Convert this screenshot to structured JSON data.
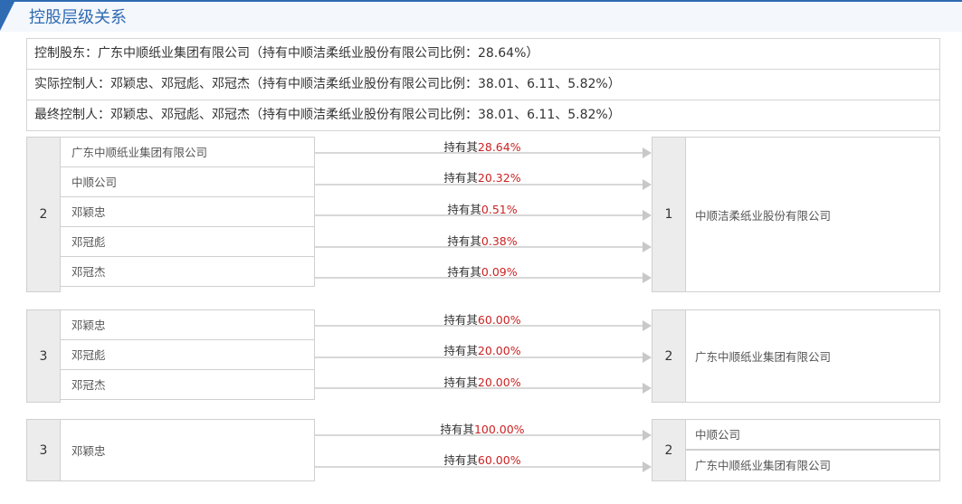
{
  "header": {
    "title": "控股层级关系"
  },
  "summary": {
    "rows": [
      "控制股东：广东中顺纸业集团有限公司（持有中顺洁柔纸业股份有限公司比例：28.64%）",
      "实际控制人：邓颖忠、邓冠彪、邓冠杰（持有中顺洁柔纸业股份有限公司比例：38.01、6.11、5.82%）",
      "最终控制人：邓颖忠、邓冠彪、邓冠杰（持有中顺洁柔纸业股份有限公司比例：38.01、6.11、5.82%）"
    ]
  },
  "blocks": [
    {
      "left_level": "2",
      "holders": [
        "广东中顺纸业集团有限公司",
        "中顺公司",
        "邓颖忠",
        "邓冠彪",
        "邓冠杰"
      ],
      "arrows": [
        {
          "prefix": "持有其",
          "pct": "28.64%"
        },
        {
          "prefix": "持有其",
          "pct": "20.32%"
        },
        {
          "prefix": "持有其",
          "pct": "0.51%"
        },
        {
          "prefix": "持有其",
          "pct": "0.38%"
        },
        {
          "prefix": "持有其",
          "pct": "0.09%"
        }
      ],
      "right_level": "1",
      "targets": [
        "中顺洁柔纸业股份有限公司"
      ]
    },
    {
      "left_level": "3",
      "holders": [
        "邓颖忠",
        "邓冠彪",
        "邓冠杰"
      ],
      "arrows": [
        {
          "prefix": "持有其",
          "pct": "60.00%"
        },
        {
          "prefix": "持有其",
          "pct": "20.00%"
        },
        {
          "prefix": "持有其",
          "pct": "20.00%"
        }
      ],
      "right_level": "2",
      "targets": [
        "广东中顺纸业集团有限公司"
      ]
    },
    {
      "left_level": "3",
      "holders": [
        "邓颖忠"
      ],
      "arrows": [
        {
          "prefix": "持有其",
          "pct": "100.00%"
        },
        {
          "prefix": "持有其",
          "pct": "60.00%"
        }
      ],
      "right_level": "2",
      "targets": [
        "中顺公司",
        "广东中顺纸业集团有限公司"
      ]
    }
  ]
}
